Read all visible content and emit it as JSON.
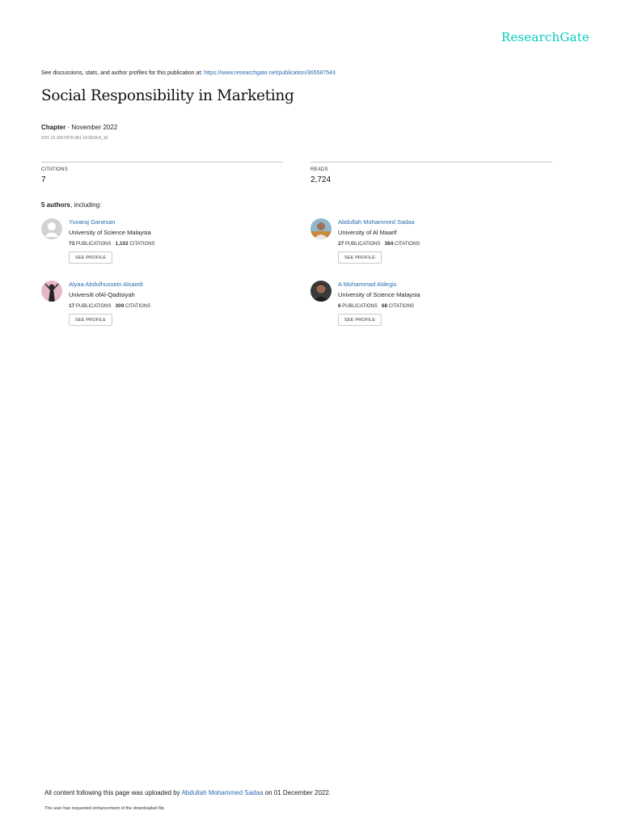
{
  "brand": {
    "logo_text": "ResearchGate",
    "accent_color": "#00ccbb",
    "link_color": "#2a6cb0"
  },
  "header": {
    "discussion_prefix": "See discussions, stats, and author profiles for this publication at: ",
    "publication_url": "https://www.researchgate.net/publication/365587543"
  },
  "publication": {
    "title": "Social Responsibility in Marketing",
    "type": "Chapter",
    "date": " · November 2022",
    "doi": "DOI: 10.1007/978-981-19-6509-8_16"
  },
  "stats": {
    "citations_label": "CITATIONS",
    "citations_value": "7",
    "reads_label": "READS",
    "reads_value": "2,724"
  },
  "authors_section": {
    "count_label": "5 authors",
    "suffix": ", including:"
  },
  "authors": [
    {
      "name": "Yuvaraj Ganesan",
      "institution": "University of Science Malaysia",
      "publications": "73",
      "publications_label": "PUBLICATIONS",
      "citations": "1,102",
      "citations_label": "CITATIONS",
      "button": "SEE PROFILE",
      "avatar_icon": "default-avatar-icon"
    },
    {
      "name": "Abdullah Mohammed Sadaa",
      "institution": "University of Al Maarif",
      "publications": "27",
      "publications_label": "PUBLICATIONS",
      "citations": "384",
      "citations_label": "CITATIONS",
      "button": "SEE PROFILE",
      "avatar_icon": "photo-avatar-icon"
    },
    {
      "name": "Alyaa Abdulhussein Alsaedi",
      "institution": "Universiti ofAl-Qadisiyah",
      "publications": "17",
      "publications_label": "PUBLICATIONS",
      "citations": "309",
      "citations_label": "CITATIONS",
      "button": "SEE PROFILE",
      "avatar_icon": "photo-avatar-icon"
    },
    {
      "name": "A Mohammad Aldegis",
      "institution": "University of Science Malaysia",
      "publications": "6",
      "publications_label": "PUBLICATIONS",
      "citations": "68",
      "citations_label": "CITATIONS",
      "button": "SEE PROFILE",
      "avatar_icon": "photo-avatar-icon"
    }
  ],
  "footer": {
    "uploaded_prefix": "All content following this page was uploaded by ",
    "uploader": "Abdullah Mohammed Sadaa",
    "uploaded_suffix": " on 01 December 2022.",
    "note": "The user has requested enhancement of the downloaded file."
  }
}
